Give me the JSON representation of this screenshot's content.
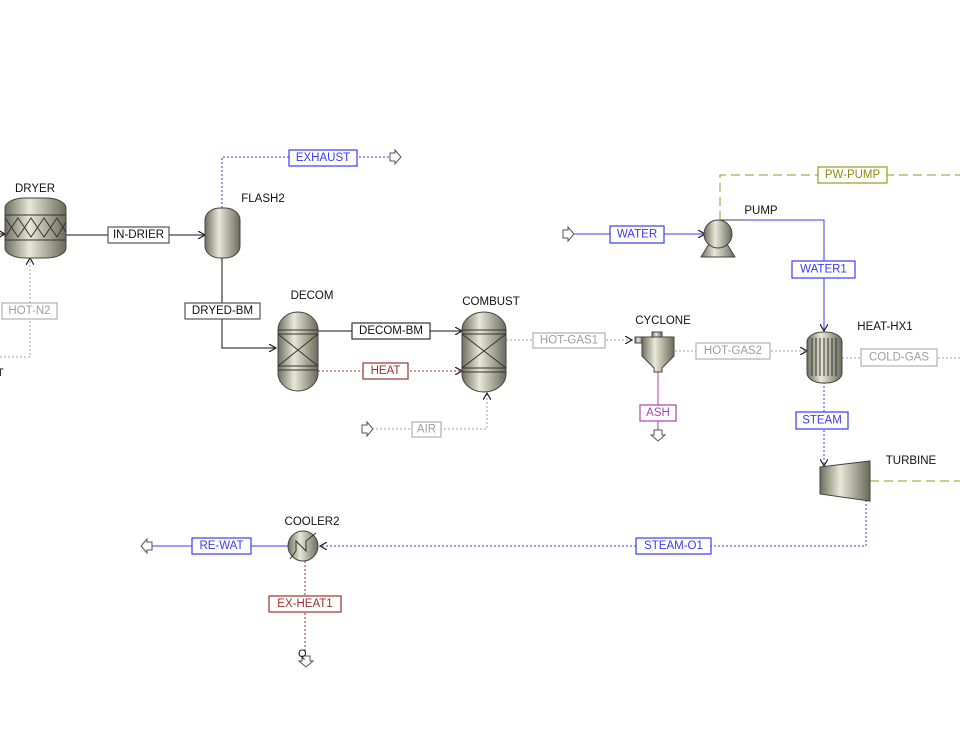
{
  "blocks": {
    "dryer": "DRYER",
    "flash2": "FLASH2",
    "decom": "DECOM",
    "combust": "COMBUST",
    "cyclone": "CYCLONE",
    "pump": "PUMP",
    "heat_hx1": "HEAT-HX1",
    "turbine": "TURBINE",
    "cooler2": "COOLER2",
    "cut_label": "T"
  },
  "streams": {
    "in_drier": "IN-DRIER",
    "exhaust": "EXHAUST",
    "hot_n2": "HOT-N2",
    "dryed_bm": "DRYED-BM",
    "decom_bm": "DECOM-BM",
    "heat": "HEAT",
    "air": "AIR",
    "hot_gas1": "HOT-GAS1",
    "hot_gas2": "HOT-GAS2",
    "ash": "ASH",
    "cold_gas": "COLD-GAS",
    "water": "WATER",
    "water1": "WATER1",
    "pw_pump": "PW-PUMP",
    "steam": "STEAM",
    "steam_o1": "STEAM-O1",
    "re_wat": "RE-WAT",
    "ex_heat1": "EX-HEAT1",
    "heat_symbol": "Q"
  },
  "colors": {
    "material": "#111111",
    "water_stream": "#3a3aff",
    "gas_stream": "#a0a0a0",
    "heat_stream": "#a03030",
    "work_stream": "#9a9a20",
    "ash_stream": "#b040b0"
  }
}
